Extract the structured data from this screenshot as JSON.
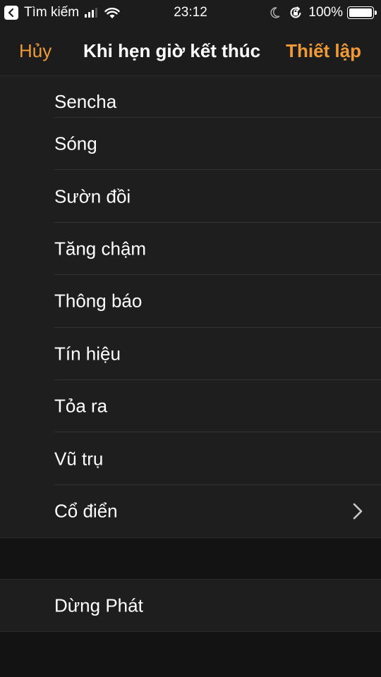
{
  "status_bar": {
    "back_app_label": "Tìm kiếm",
    "time": "23:12",
    "battery_percent": "100%",
    "signal_bars_active": 3,
    "signal_bars_total": 4,
    "battery_level": 1.0
  },
  "nav": {
    "cancel_label": "Hủy",
    "title": "Khi hẹn giờ kết thúc",
    "set_label": "Thiết lập",
    "accent_color": "#f09a37"
  },
  "list": {
    "items": [
      {
        "label": "Sencha"
      },
      {
        "label": "Sóng"
      },
      {
        "label": "Sườn đồi"
      },
      {
        "label": "Tăng chậm"
      },
      {
        "label": "Thông báo"
      },
      {
        "label": "Tín hiệu"
      },
      {
        "label": "Tỏa ra"
      },
      {
        "label": "Vũ trụ"
      },
      {
        "label": "Cổ điển",
        "icon": "chevron-right-icon"
      }
    ]
  },
  "stop_section": {
    "label": "Dừng Phát"
  }
}
